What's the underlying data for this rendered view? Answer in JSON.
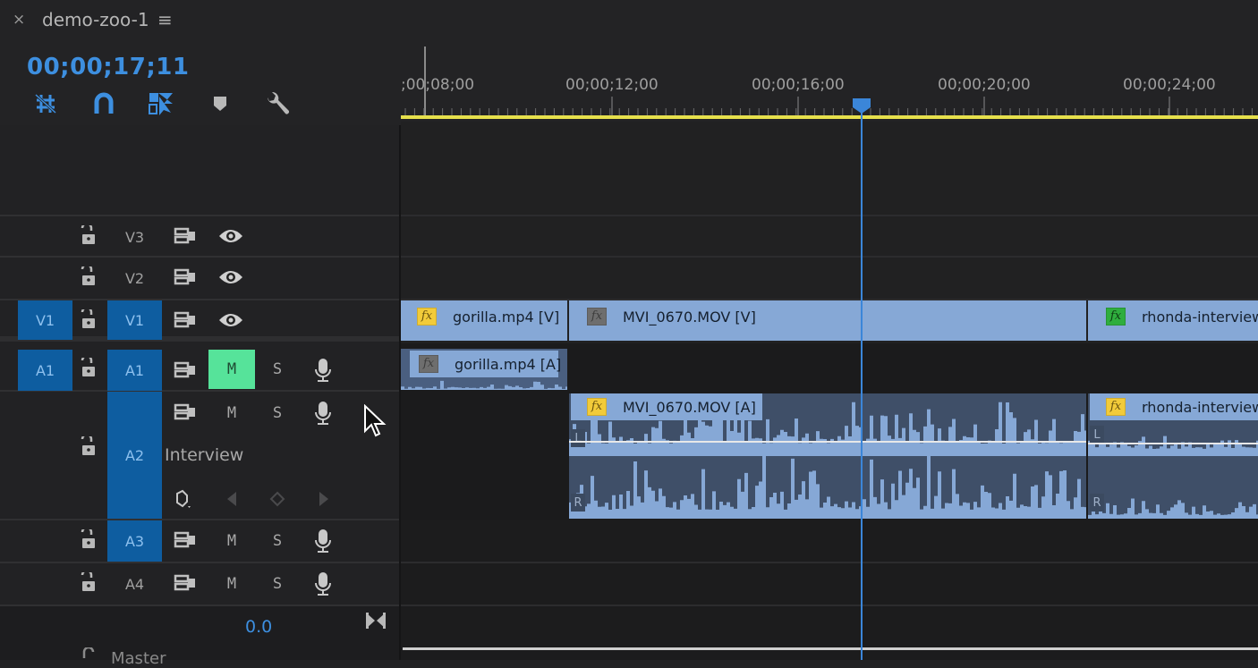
{
  "sequence": {
    "close_glyph": "×",
    "title": "demo-zoo-1",
    "menu_glyph": "≡",
    "timecode": "00;00;17;11"
  },
  "toolbar": {
    "tools": [
      {
        "name": "insert-overwrite-nest-icon",
        "active": true
      },
      {
        "name": "snap-magnet-icon",
        "active": true
      },
      {
        "name": "linked-selection-icon",
        "active": true
      },
      {
        "name": "add-marker-icon",
        "active": false
      },
      {
        "name": "timeline-settings-wrench-icon",
        "active": false
      }
    ]
  },
  "ruler": {
    "labels": [
      ";00;08;00",
      "00;00;12;00",
      "00;00;16;00",
      "00;00;20;00",
      "00;00;24;00"
    ],
    "playhead_timecode": "00;00;17;11"
  },
  "tracks": {
    "video": [
      {
        "id": "V3",
        "source_patch": "",
        "targeted": false,
        "lock": "unlocked",
        "visible": true
      },
      {
        "id": "V2",
        "source_patch": "",
        "targeted": false,
        "lock": "unlocked",
        "visible": true
      },
      {
        "id": "V1",
        "source_patch": "V1",
        "targeted": true,
        "lock": "unlocked",
        "visible": true
      }
    ],
    "audio": [
      {
        "id": "A1",
        "source_patch": "A1",
        "targeted": true,
        "mute": "M",
        "mute_on": true,
        "solo": "S",
        "lock": "unlocked"
      },
      {
        "id": "A2",
        "source_patch": "",
        "targeted": true,
        "mute": "M",
        "mute_on": false,
        "solo": "S",
        "lock": "unlocked",
        "name": "Interview"
      },
      {
        "id": "A3",
        "source_patch": "",
        "targeted": true,
        "mute": "M",
        "mute_on": false,
        "solo": "S",
        "lock": "unlocked"
      },
      {
        "id": "A4",
        "source_patch": "",
        "targeted": false,
        "mute": "M",
        "mute_on": false,
        "solo": "S",
        "lock": "unlocked"
      }
    ],
    "master": {
      "label": "Master",
      "volume": "0.0"
    }
  },
  "clips": {
    "v1": [
      {
        "name": "gorilla.mp4 [V]",
        "fx": "yellow"
      },
      {
        "name": "MVI_0670.MOV [V]",
        "fx": "none"
      },
      {
        "name": "rhonda-interview",
        "fx": "green"
      }
    ],
    "a1": [
      {
        "name": "gorilla.mp4 [A]",
        "fx": "none"
      }
    ],
    "a2": [
      {
        "name": "MVI_0670.MOV [A]",
        "fx": "yellow",
        "channels": [
          "L",
          "R"
        ]
      },
      {
        "name": "rhonda-interview",
        "fx": "yellow",
        "channels": [
          "L",
          "R"
        ]
      }
    ]
  },
  "fx_label": "fx",
  "colors": {
    "accent_blue": "#3d8fe0",
    "track_target": "#0e5da0",
    "mute_on": "#56e39a",
    "clip": "#86a8d6",
    "work_area_bar": "#e6e04c",
    "playhead": "#3b86d9"
  }
}
